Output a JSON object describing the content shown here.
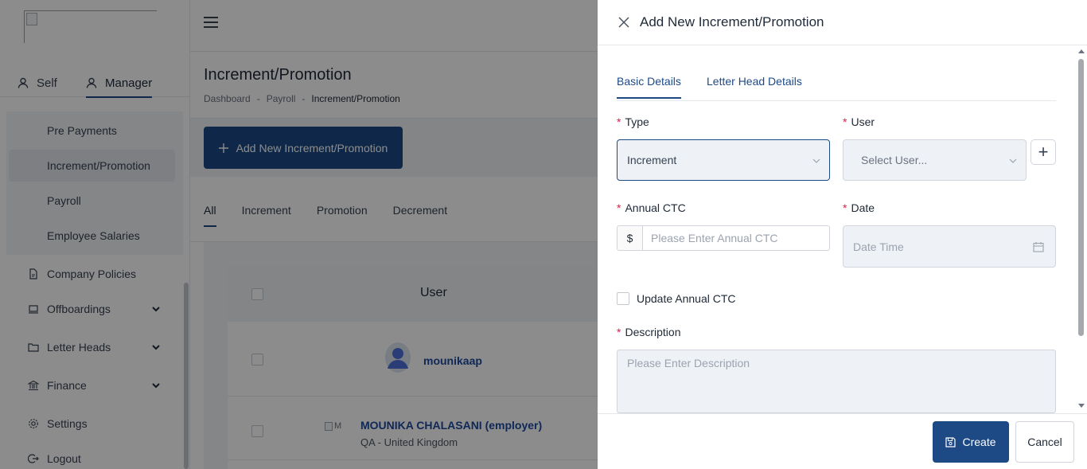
{
  "sidebar": {
    "modes": [
      {
        "label": "Self"
      },
      {
        "label": "Manager"
      }
    ],
    "submenu": [
      {
        "label": "Pre Payments"
      },
      {
        "label": "Increment/Promotion"
      },
      {
        "label": "Payroll"
      },
      {
        "label": "Employee Salaries"
      }
    ],
    "items": [
      {
        "label": "Company Policies",
        "icon": "document-icon"
      },
      {
        "label": "Offboardings",
        "icon": "laptop-icon"
      },
      {
        "label": "Letter Heads",
        "icon": "folder-icon"
      },
      {
        "label": "Finance",
        "icon": "bank-icon"
      },
      {
        "label": "Settings",
        "icon": "gear-icon"
      },
      {
        "label": "Logout",
        "icon": "logout-icon"
      }
    ]
  },
  "page": {
    "title": "Increment/Promotion",
    "breadcrumb": [
      "Dashboard",
      "Payroll",
      "Increment/Promotion"
    ],
    "breadcrumb_sep": "-",
    "add_button": "Add New Increment/Promotion",
    "filter_tabs": [
      "All",
      "Increment",
      "Promotion",
      "Decrement"
    ],
    "table": {
      "header_user": "User",
      "rows": [
        {
          "name": "mounikaap",
          "sub": ""
        },
        {
          "name": "MOUNIKA CHALASANI (employer)",
          "sub": "QA - United Kingdom",
          "img_alt": "M"
        }
      ]
    }
  },
  "drawer": {
    "title": "Add New Increment/Promotion",
    "tabs": [
      "Basic Details",
      "Letter Head Details"
    ],
    "fields": {
      "type_label": "Type",
      "type_value": "Increment",
      "user_label": "User",
      "user_placeholder": "Select User...",
      "ctc_label": "Annual CTC",
      "ctc_prefix": "$",
      "ctc_placeholder": "Please Enter Annual CTC",
      "date_label": "Date",
      "date_placeholder": "Date Time",
      "update_ctc_label": "Update Annual CTC",
      "desc_label": "Description",
      "desc_placeholder": "Please Enter Description",
      "required_mark": "*",
      "add_user_symbol": "+"
    },
    "buttons": {
      "create": "Create",
      "cancel": "Cancel"
    }
  },
  "colors": {
    "primary": "#1d4a85",
    "required": "#e11d48",
    "link": "#1d4a9e"
  }
}
